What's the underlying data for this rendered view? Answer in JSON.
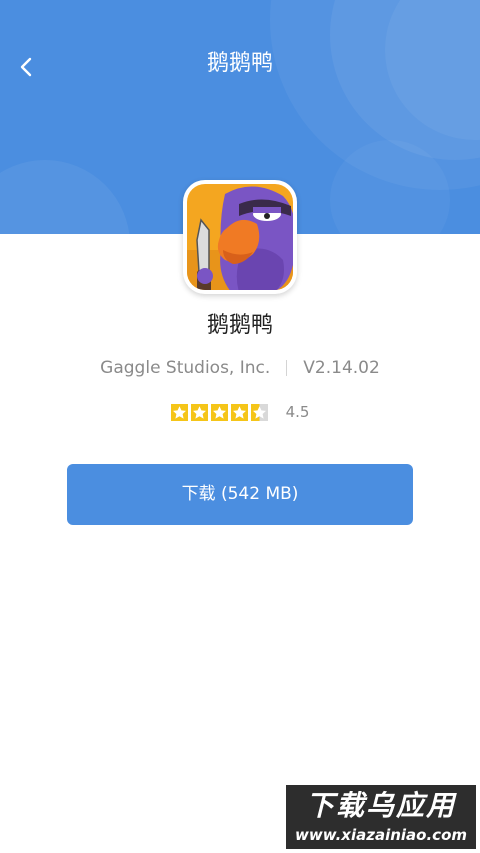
{
  "header": {
    "title": "鹅鹅鸭",
    "back_icon": "chevron-left-icon",
    "background_color": "#4b8ee0"
  },
  "app": {
    "name": "鹅鹅鸭",
    "developer": "Gaggle Studios, Inc.",
    "version": "V2.14.02",
    "rating": 4.5,
    "rating_text": "4.5",
    "stars_max": 5,
    "star_color": "#f5c518"
  },
  "download": {
    "label": "下载 (542 MB)",
    "color": "#4b8ee0"
  },
  "watermark": {
    "top_text": "下载乌应用",
    "bottom_text": "www.xiazainiao.com"
  }
}
